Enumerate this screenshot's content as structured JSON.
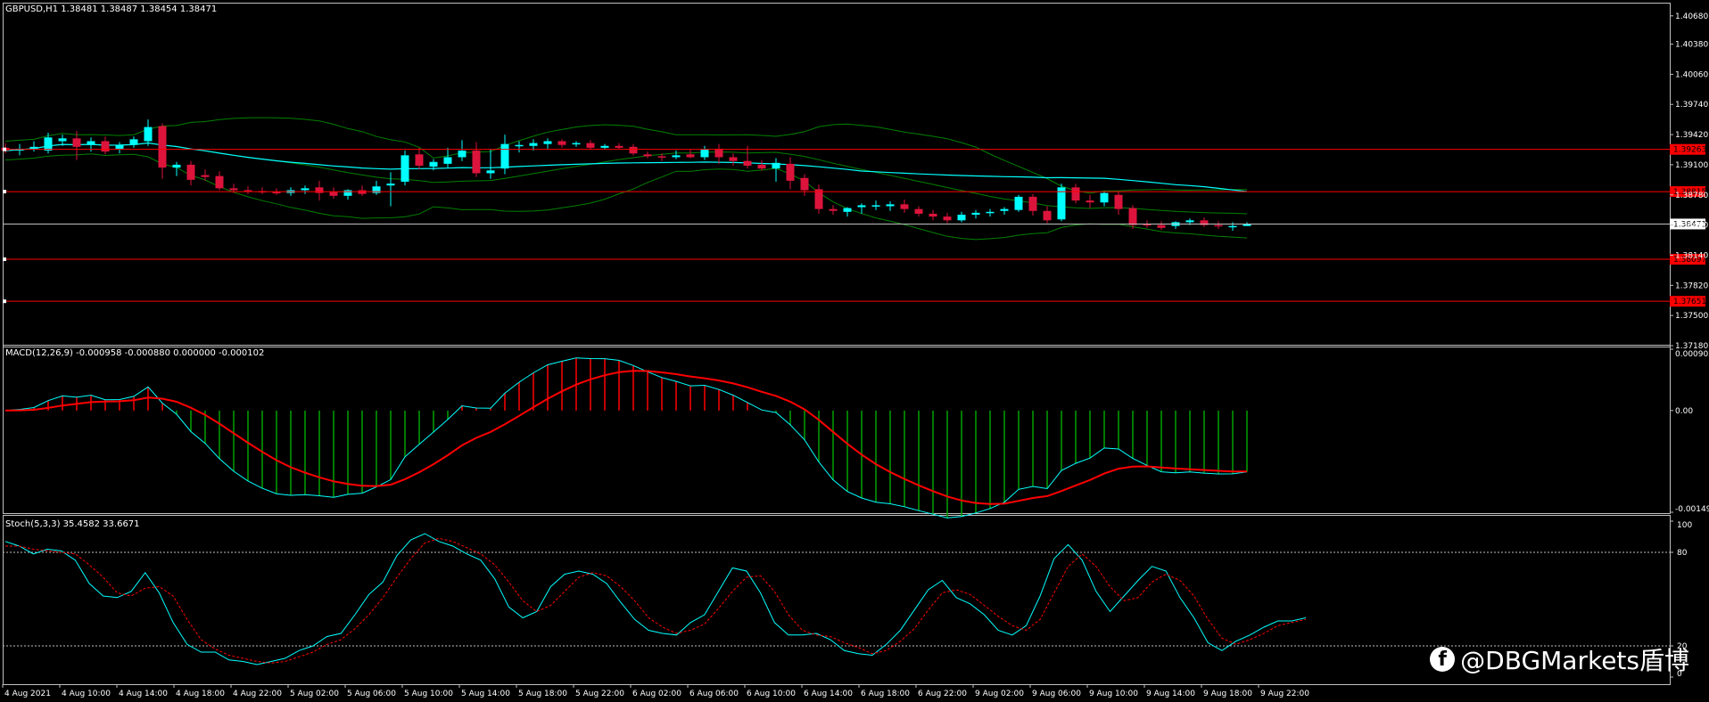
{
  "main": {
    "title": "GBPUSD,H1  1.38481 1.38487 1.38454 1.38471",
    "last_price_label": "1.38471",
    "right_ticks": [
      "1.40680",
      "1.40380",
      "1.40060",
      "1.39740",
      "1.39420",
      "1.39100",
      "1.38780",
      "1.38460",
      "1.38140",
      "1.37820",
      "1.37500",
      "1.37180"
    ],
    "level_labels": [
      "1.39263",
      "1.38815",
      "1.38097",
      "1.37651"
    ]
  },
  "macd": {
    "title": "MACD(12,26,9) -0.000958 -0.000880 0.000000 -0.000102",
    "ticks": [
      "0.000902",
      "0.00",
      "-0.001496"
    ]
  },
  "stoch": {
    "title": "Stoch(5,3,3) 35.4582 33.6671",
    "ticks": [
      "100",
      "80",
      "20",
      "0"
    ]
  },
  "time_axis": [
    "4 Aug 2021",
    "4 Aug 10:00",
    "4 Aug 14:00",
    "4 Aug 18:00",
    "4 Aug 22:00",
    "5 Aug 02:00",
    "5 Aug 06:00",
    "5 Aug 10:00",
    "5 Aug 14:00",
    "5 Aug 18:00",
    "5 Aug 22:00",
    "6 Aug 02:00",
    "6 Aug 06:00",
    "6 Aug 10:00",
    "6 Aug 14:00",
    "6 Aug 18:00",
    "6 Aug 22:00",
    "9 Aug 02:00",
    "9 Aug 06:00",
    "9 Aug 10:00",
    "9 Aug 14:00",
    "9 Aug 18:00",
    "9 Aug 22:00"
  ],
  "watermark": "@DBGMarkets盾博",
  "colors": {
    "bull": "#00ffff",
    "bear": "#dc143c",
    "level": "#ff0000",
    "band": "#008000",
    "ma": "#00ffff",
    "hist_pos": "#ff0000",
    "hist_neg": "#00a000"
  },
  "chart_data": [
    {
      "type": "candlestick",
      "title": "GBPUSD,H1",
      "ylim": [
        1.3718,
        1.4082
      ],
      "horizontal_levels": [
        1.39263,
        1.38815,
        1.38097,
        1.37651
      ],
      "last_price": 1.38471,
      "candles": [
        [
          1.3928,
          1.3933,
          1.3922,
          1.3925
        ],
        [
          1.3925,
          1.3932,
          1.392,
          1.3927
        ],
        [
          1.3927,
          1.3935,
          1.3924,
          1.3929
        ],
        [
          1.3925,
          1.3944,
          1.3922,
          1.3939
        ],
        [
          1.3935,
          1.3942,
          1.393,
          1.3938
        ],
        [
          1.3938,
          1.3946,
          1.3915,
          1.3929
        ],
        [
          1.3931,
          1.3939,
          1.3924,
          1.3935
        ],
        [
          1.3935,
          1.394,
          1.3921,
          1.3924
        ],
        [
          1.3927,
          1.3934,
          1.3922,
          1.3931
        ],
        [
          1.3931,
          1.394,
          1.3928,
          1.3937
        ],
        [
          1.3935,
          1.3958,
          1.393,
          1.395
        ],
        [
          1.3951,
          1.3954,
          1.3895,
          1.3907
        ],
        [
          1.3907,
          1.3913,
          1.3898,
          1.391
        ],
        [
          1.391,
          1.3914,
          1.3888,
          1.3894
        ],
        [
          1.3899,
          1.3905,
          1.3893,
          1.3897
        ],
        [
          1.3898,
          1.3903,
          1.3883,
          1.3885
        ],
        [
          1.3885,
          1.389,
          1.388,
          1.3883
        ],
        [
          1.3883,
          1.3887,
          1.3879,
          1.3882
        ],
        [
          1.3882,
          1.3886,
          1.3879,
          1.3881
        ],
        [
          1.3881,
          1.3885,
          1.3878,
          1.388
        ],
        [
          1.388,
          1.3886,
          1.3877,
          1.3883
        ],
        [
          1.3883,
          1.3888,
          1.3879,
          1.3885
        ],
        [
          1.3886,
          1.3893,
          1.3872,
          1.388
        ],
        [
          1.3881,
          1.3886,
          1.3874,
          1.3877
        ],
        [
          1.3877,
          1.3884,
          1.3873,
          1.3883
        ],
        [
          1.3883,
          1.3888,
          1.3877,
          1.3879
        ],
        [
          1.388,
          1.3893,
          1.3878,
          1.3887
        ],
        [
          1.3888,
          1.3902,
          1.3866,
          1.389
        ],
        [
          1.3892,
          1.3925,
          1.3888,
          1.392
        ],
        [
          1.3921,
          1.3928,
          1.3905,
          1.3909
        ],
        [
          1.3908,
          1.3916,
          1.3904,
          1.3913
        ],
        [
          1.3911,
          1.3928,
          1.3907,
          1.3918
        ],
        [
          1.3918,
          1.3936,
          1.3914,
          1.3925
        ],
        [
          1.3925,
          1.3934,
          1.3897,
          1.3901
        ],
        [
          1.3901,
          1.3927,
          1.3895,
          1.3904
        ],
        [
          1.3906,
          1.3942,
          1.39,
          1.3932
        ],
        [
          1.393,
          1.3935,
          1.3923,
          1.3931
        ],
        [
          1.393,
          1.3937,
          1.3925,
          1.3933
        ],
        [
          1.3932,
          1.3938,
          1.3927,
          1.3935
        ],
        [
          1.3935,
          1.3937,
          1.3928,
          1.3931
        ],
        [
          1.3932,
          1.3935,
          1.3929,
          1.3933
        ],
        [
          1.3933,
          1.3936,
          1.3926,
          1.3928
        ],
        [
          1.3928,
          1.3932,
          1.3926,
          1.393
        ],
        [
          1.393,
          1.3933,
          1.3927,
          1.3928
        ],
        [
          1.3929,
          1.3932,
          1.392,
          1.3922
        ],
        [
          1.3921,
          1.3924,
          1.3917,
          1.3919
        ],
        [
          1.3919,
          1.3922,
          1.3914,
          1.3918
        ],
        [
          1.3918,
          1.3925,
          1.3916,
          1.392
        ],
        [
          1.3921,
          1.3926,
          1.3917,
          1.3918
        ],
        [
          1.3918,
          1.393,
          1.3915,
          1.3926
        ],
        [
          1.3927,
          1.3932,
          1.3911,
          1.3918
        ],
        [
          1.3918,
          1.3922,
          1.3909,
          1.3914
        ],
        [
          1.3914,
          1.393,
          1.3906,
          1.3909
        ],
        [
          1.391,
          1.3915,
          1.3904,
          1.3906
        ],
        [
          1.3906,
          1.3917,
          1.3892,
          1.3912
        ],
        [
          1.3911,
          1.3918,
          1.3884,
          1.3893
        ],
        [
          1.3896,
          1.39,
          1.3877,
          1.3883
        ],
        [
          1.3884,
          1.3889,
          1.3858,
          1.3863
        ],
        [
          1.3863,
          1.3867,
          1.3857,
          1.3861
        ],
        [
          1.386,
          1.3865,
          1.3855,
          1.3864
        ],
        [
          1.3865,
          1.3869,
          1.3858,
          1.3867
        ],
        [
          1.3866,
          1.3872,
          1.3862,
          1.3867
        ],
        [
          1.3866,
          1.3871,
          1.3861,
          1.3868
        ],
        [
          1.3868,
          1.3873,
          1.3859,
          1.3863
        ],
        [
          1.3863,
          1.3866,
          1.3855,
          1.3858
        ],
        [
          1.3858,
          1.3862,
          1.3851,
          1.3855
        ],
        [
          1.3855,
          1.3859,
          1.3848,
          1.3851
        ],
        [
          1.3851,
          1.386,
          1.3849,
          1.3857
        ],
        [
          1.3857,
          1.3862,
          1.3853,
          1.3859
        ],
        [
          1.3859,
          1.3863,
          1.3855,
          1.386
        ],
        [
          1.3861,
          1.3865,
          1.3857,
          1.3863
        ],
        [
          1.3862,
          1.3878,
          1.386,
          1.3876
        ],
        [
          1.3876,
          1.3879,
          1.3856,
          1.3861
        ],
        [
          1.3861,
          1.3866,
          1.3848,
          1.3851
        ],
        [
          1.3852,
          1.389,
          1.385,
          1.3886
        ],
        [
          1.3886,
          1.389,
          1.3869,
          1.3872
        ],
        [
          1.3872,
          1.3878,
          1.3864,
          1.387
        ],
        [
          1.387,
          1.3882,
          1.3866,
          1.388
        ],
        [
          1.3878,
          1.3882,
          1.3857,
          1.3863
        ],
        [
          1.3864,
          1.3867,
          1.3842,
          1.3846
        ],
        [
          1.3847,
          1.3851,
          1.3843,
          1.3846
        ],
        [
          1.3846,
          1.385,
          1.3841,
          1.3843
        ],
        [
          1.3845,
          1.385,
          1.3842,
          1.3849
        ],
        [
          1.3849,
          1.3853,
          1.3846,
          1.3851
        ],
        [
          1.3851,
          1.3854,
          1.3844,
          1.3846
        ],
        [
          1.3846,
          1.385,
          1.3842,
          1.3845
        ],
        [
          1.3844,
          1.3849,
          1.384,
          1.3845
        ],
        [
          1.3845,
          1.3849,
          1.3845,
          1.3847
        ]
      ]
    },
    {
      "type": "line",
      "title": "MACD(12,26,9)",
      "values_display": [
        -0.000958,
        -0.00088
      ],
      "ylim": [
        -0.001496,
        0.000902
      ]
    },
    {
      "type": "line",
      "title": "Stoch(5,3,3)",
      "values_display": [
        35.4582,
        33.6671
      ],
      "ylim": [
        0,
        100
      ],
      "levels": [
        80,
        20
      ],
      "main": [
        87,
        84,
        79,
        82,
        81,
        75,
        60,
        52,
        51,
        55,
        67,
        54,
        35,
        21,
        16,
        16,
        11,
        10,
        8,
        10,
        12,
        17,
        20,
        26,
        28,
        40,
        53,
        61,
        78,
        88,
        92,
        87,
        84,
        79,
        75,
        63,
        45,
        38,
        42,
        58,
        66,
        68,
        66,
        60,
        48,
        37,
        30,
        28,
        27,
        35,
        40,
        55,
        70,
        68,
        54,
        35,
        27,
        27,
        28,
        24,
        17,
        15,
        14,
        21,
        30,
        43,
        56,
        62,
        51,
        47,
        40,
        30,
        27,
        33,
        52,
        76,
        85,
        75,
        55,
        42,
        52,
        62,
        71,
        68,
        51,
        38,
        22,
        17,
        23,
        27,
        32,
        36,
        36,
        38
      ],
      "signal": [
        84,
        84,
        82,
        81,
        80,
        79,
        72,
        64,
        54,
        52,
        57,
        58,
        52,
        37,
        24,
        18,
        14,
        12,
        10,
        9,
        10,
        13,
        16,
        21,
        24,
        31,
        40,
        51,
        64,
        76,
        86,
        89,
        87,
        83,
        79,
        72,
        61,
        49,
        42,
        46,
        55,
        64,
        67,
        65,
        58,
        49,
        38,
        32,
        28,
        30,
        34,
        44,
        55,
        64,
        65,
        55,
        40,
        30,
        27,
        26,
        22,
        19,
        15,
        17,
        23,
        31,
        43,
        54,
        56,
        53,
        46,
        39,
        33,
        30,
        37,
        54,
        71,
        79,
        71,
        58,
        49,
        51,
        61,
        66,
        62,
        52,
        37,
        25,
        21,
        24,
        28,
        33,
        35,
        37
      ]
    }
  ]
}
